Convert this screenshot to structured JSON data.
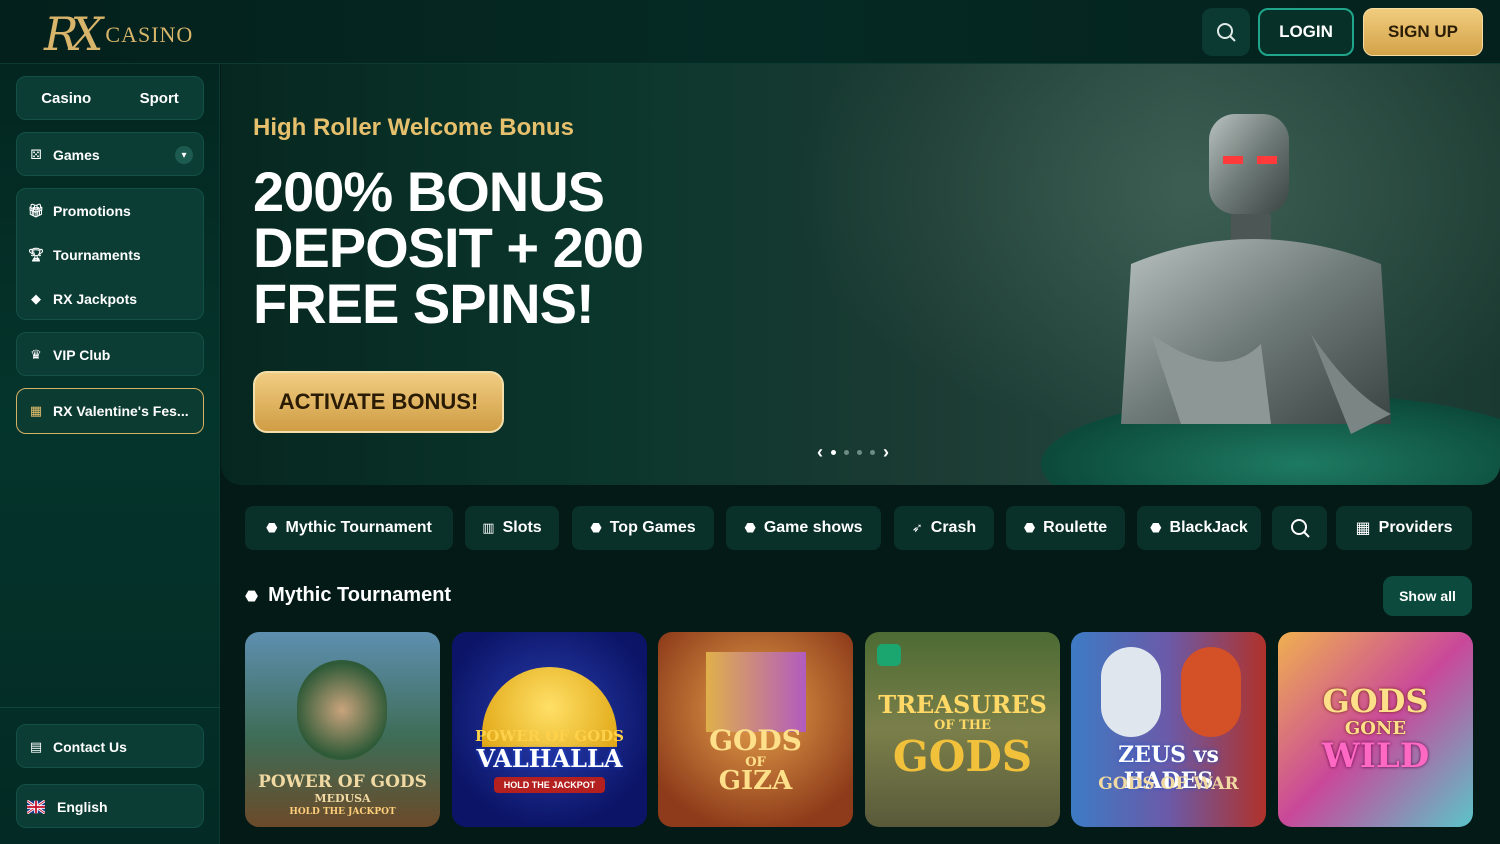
{
  "header": {
    "logo_mark": "RX",
    "logo_text": "CASINO",
    "login_label": "LOGIN",
    "signup_label": "SIGN UP"
  },
  "sidebar": {
    "toggle": [
      "Casino",
      "Sport"
    ],
    "games_label": "Games",
    "group_items": [
      "Promotions",
      "Tournaments",
      "RX Jackpots"
    ],
    "vip_label": "VIP Club",
    "promo_label": "RX Valentine's Fes...",
    "contact_label": "Contact Us",
    "language_label": "English"
  },
  "hero": {
    "subtitle": "High Roller Welcome Bonus",
    "title_line1": "200% BONUS",
    "title_line2": "DEPOSIT + 200",
    "title_line3": "FREE SPINS!",
    "cta_label": "ACTIVATE BONUS!"
  },
  "categories": [
    {
      "label": "Mythic Tournament"
    },
    {
      "label": "Slots"
    },
    {
      "label": "Top Games"
    },
    {
      "label": "Game shows"
    },
    {
      "label": "Crash"
    },
    {
      "label": "Roulette"
    },
    {
      "label": "BlackJack"
    },
    {
      "label": "Providers"
    }
  ],
  "section": {
    "title": "Mythic Tournament",
    "show_all_label": "Show all"
  },
  "games": [
    {
      "line1": "POWER OF GODS",
      "line2": "MEDUSA",
      "line3": "HOLD THE JACKPOT"
    },
    {
      "line1": "POWER OF GODS",
      "line2": "VALHALLA",
      "line3": "HOLD THE JACKPOT"
    },
    {
      "line1": "GODS",
      "line2": "OF",
      "line3": "GIZA"
    },
    {
      "line1": "TREASURES",
      "line2": "OF THE",
      "line3": "GODS"
    },
    {
      "line1": "ZEUS vs HADES",
      "line2": "GODS OF WAR",
      "line3": ""
    },
    {
      "line1": "GODS",
      "line2": "GONE",
      "line3": "WILD"
    }
  ],
  "colors": {
    "gold": "#e6c06d",
    "panel": "#0b3d34",
    "background": "#031a17"
  }
}
